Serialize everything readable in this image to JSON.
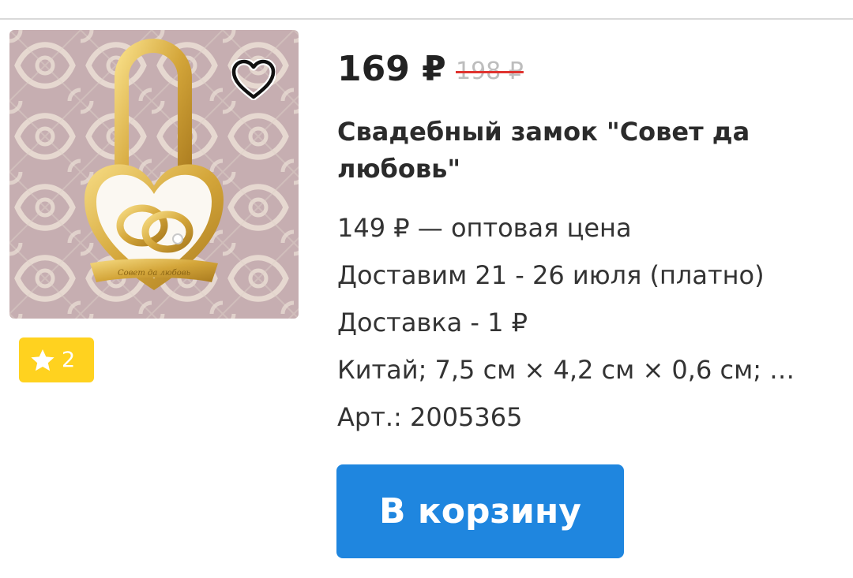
{
  "product": {
    "price": "169 ₽",
    "old_price": "198 ₽",
    "title": "Свадебный замок \"Совет да любовь\"",
    "wholesale": "149 ₽ — оптовая цена",
    "delivery_dates": "Доставим 21 - 26 июля (платно)",
    "delivery_cost": "Доставка - 1 ₽",
    "specs": "Китай; 7,5 см × 4,2 см × 0,6 см; М...",
    "article": "Арт.: 2005365",
    "image_engraving": "Совет да любовь"
  },
  "rating": {
    "count": "2",
    "icon": "star-icon"
  },
  "favorite": {
    "icon": "heart-outline-icon"
  },
  "cart_button": {
    "label": "В корзину"
  },
  "colors": {
    "accent": "#1f86df",
    "badge": "#ffd21f",
    "strike": "#e0332f"
  }
}
